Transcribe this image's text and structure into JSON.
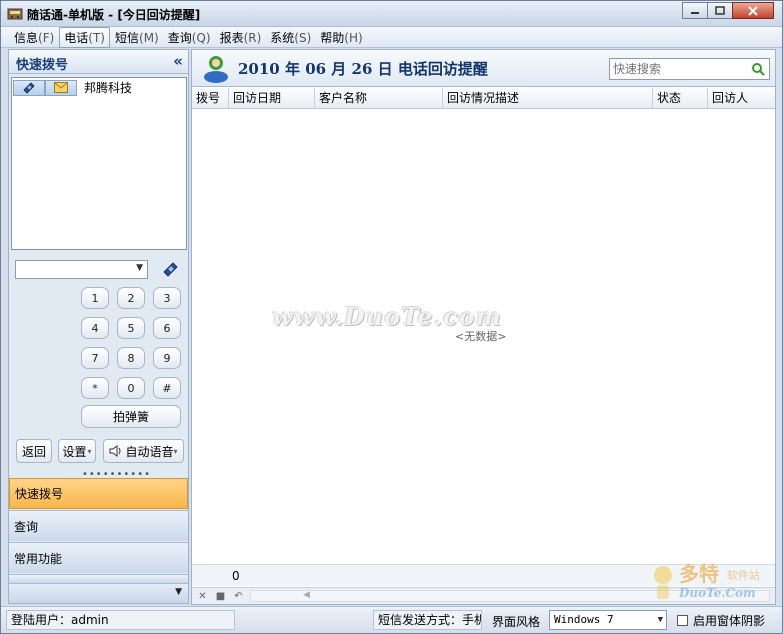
{
  "window": {
    "title": "随话通-单机版 - [今日回访提醒]",
    "buttons": [
      "minimize",
      "maximize",
      "close"
    ]
  },
  "menu": [
    {
      "label": "信息",
      "key": "(F)"
    },
    {
      "label": "电话",
      "key": "(T)"
    },
    {
      "label": "短信",
      "key": "(M)"
    },
    {
      "label": "查询",
      "key": "(Q)"
    },
    {
      "label": "报表",
      "key": "(R)"
    },
    {
      "label": "系统",
      "key": "(S)"
    },
    {
      "label": "帮助",
      "key": "(H)"
    }
  ],
  "left": {
    "title": "快速拨号",
    "collapse": "«",
    "contact": {
      "name": "邦腾科技"
    },
    "dial_value": "",
    "keys": [
      "1",
      "2",
      "3",
      "4",
      "5",
      "6",
      "7",
      "8",
      "9",
      "*",
      "0",
      "#"
    ],
    "flash_key": "拍弹簧",
    "back_button": "返回",
    "settings_button": "设置",
    "voice_button": "自动语音",
    "nav": [
      "快速拨号",
      "查询",
      "常用功能"
    ]
  },
  "main": {
    "title": "2010 年 06 月 26 日  电话回访提醒",
    "search_placeholder": "快速搜索",
    "columns": [
      "拨号",
      "回访日期",
      "客户名称",
      "回访情况描述",
      "状态",
      "回访人"
    ],
    "empty_text": "<无数据>",
    "row_count": "0",
    "watermark": "www.DuoTe.com"
  },
  "brand": {
    "text": "多特",
    "sub": "软件站",
    "domain": "DuoTe.Com"
  },
  "status": {
    "user": "登陆用户：admin",
    "sms_mode": "短信发送方式：手机",
    "style_label": "界面风格",
    "style_value": "Windows 7",
    "shadow_label": "启用窗体阴影",
    "shadow_checked": false
  },
  "colors": {
    "title_blue": "#12356e",
    "nav_active": "#f8b64a",
    "panel_bg": "#e1e9f3"
  }
}
